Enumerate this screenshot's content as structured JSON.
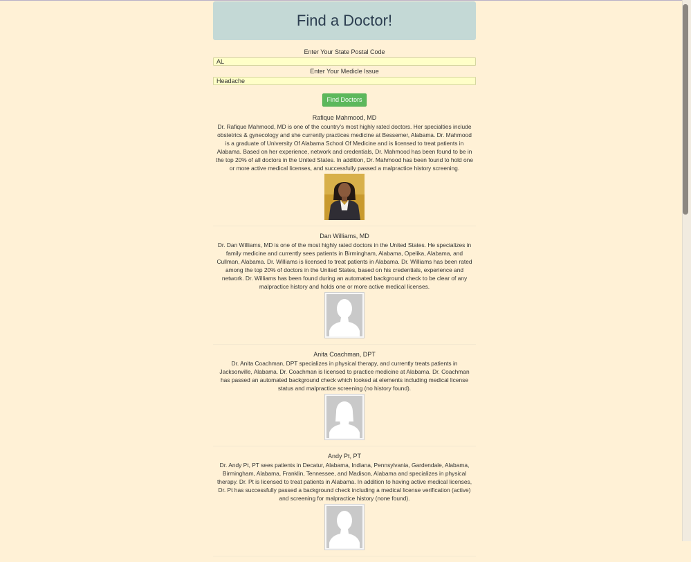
{
  "header": {
    "title": "Find a Doctor!"
  },
  "form": {
    "state_label": "Enter Your State Postal Code",
    "state_value": "AL",
    "issue_label": "Enter Your Medicle Issue",
    "issue_value": "Headache",
    "button_label": "Find Doctors"
  },
  "doctors": [
    {
      "name": "Rafique Mahmood, MD",
      "description": "Dr. Rafique Mahmood, MD is one of the country's most highly rated doctors. Her specialties include obstetrics & gynecology and she currently practices medicine at Bessemer, Alabama. Dr. Mahmood is a graduate of University Of Alabama School Of Medicine and is licensed to treat patients in Alabama. Based on her experience, network and credentials, Dr. Mahmood has been found to be in the top 20% of all doctors in the United States. In addition, Dr. Mahmood has been found to hold one or more active medical licenses, and successfully passed a malpractice history screening.",
      "photo": "photo-female"
    },
    {
      "name": "Dan Williams, MD",
      "description": "Dr. Dan Williams, MD is one of the most highly rated doctors in the United States. He specializes in family medicine and currently sees patients in Birmingham, Alabama, Opelika, Alabama, and Cullman, Alabama. Dr. Williams is licensed to treat patients in Alabama. Dr. Williams has been rated among the top 20% of doctors in the United States, based on his credentials, experience and network. Dr. Williams has been found during an automated background check to be clear of any malpractice history and holds one or more active medical licenses.",
      "photo": "placeholder-male"
    },
    {
      "name": "Anita Coachman, DPT",
      "description": "Dr. Anita Coachman, DPT specializes in physical therapy, and currently treats patients in Jacksonville, Alabama. Dr. Coachman is licensed to practice medicine at Alabama. Dr. Coachman has passed an automated background check which looked at elements including medical license status and malpractice screening (no history found).",
      "photo": "placeholder-female"
    },
    {
      "name": "Andy Pt, PT",
      "description": "Dr. Andy Pt, PT sees patients in Decatur, Alabama, Indiana, Pennsylvania, Gardendale, Alabama, Birmingham, Alabama, Franklin, Tennessee, and Madison, Alabama and specializes in physical therapy. Dr. Pt is licensed to treat patients in Alabama. In addition to having active medical licenses, Dr. Pt has successfully passed a background check including a medical license verification (active) and screening for malpractice history (none found).",
      "photo": "placeholder-male"
    }
  ]
}
